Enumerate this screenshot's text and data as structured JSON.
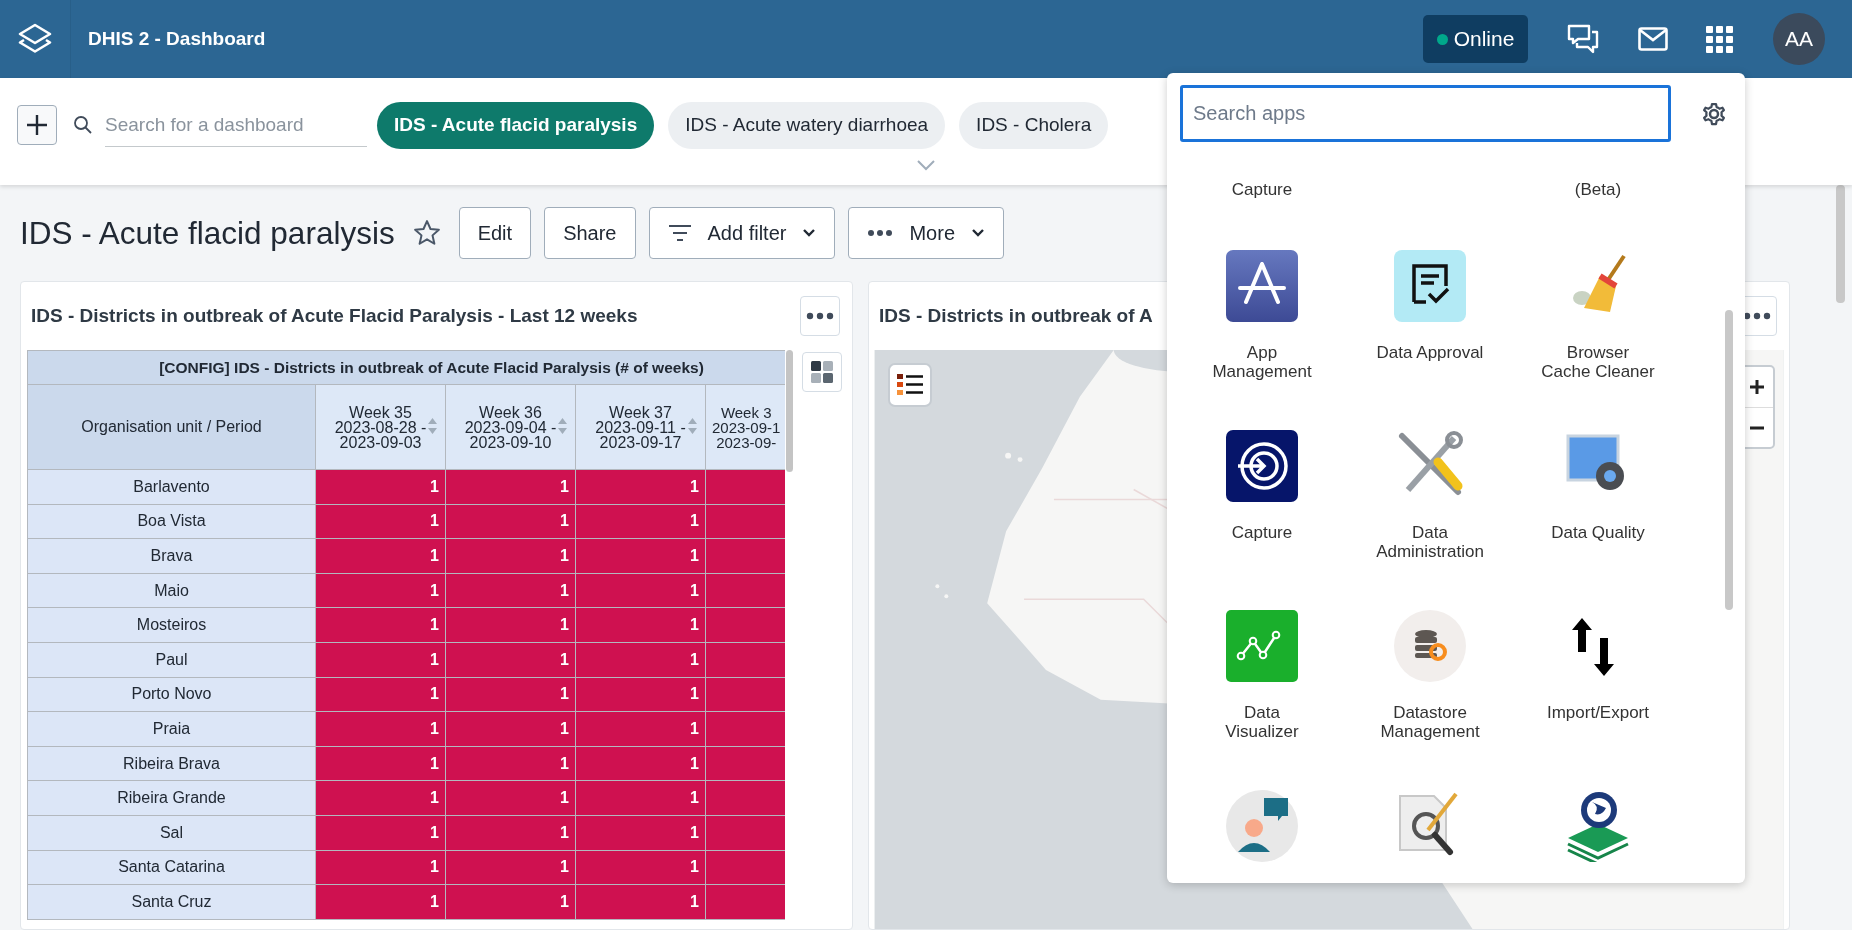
{
  "header": {
    "title": "DHIS 2 - Dashboard",
    "status": "Online",
    "avatar": "AA"
  },
  "dashboard_bar": {
    "search": {
      "placeholder": "Search for a dashboard"
    },
    "chips": [
      {
        "label": "IDS - Acute flacid paralysis",
        "selected": true
      },
      {
        "label": "IDS - Acute watery diarrhoea",
        "selected": false
      },
      {
        "label": "IDS - Cholera",
        "selected": false
      }
    ]
  },
  "dashboard": {
    "title": "IDS - Acute flacid paralysis",
    "starred": false,
    "buttons": [
      {
        "label": "Edit",
        "kind": "plain"
      },
      {
        "label": "Share",
        "kind": "plain"
      },
      {
        "label": "Add filter",
        "kind": "filter"
      },
      {
        "label": "More",
        "kind": "more"
      }
    ]
  },
  "table_item": {
    "title": "IDS - Districts in outbreak of Acute Flacid Paralysis - Last 12 weeks",
    "table": {
      "caption": "[CONFIG] IDS - Districts in outbreak of Acute Flacid Paralysis (# of weeks)",
      "corner": "Organisation unit / Period",
      "columns": [
        {
          "lines": [
            "Week 35",
            "2023-08-28 -",
            "2023-09-03"
          ],
          "sortable": true
        },
        {
          "lines": [
            "Week 36",
            "2023-09-04 -",
            "2023-09-10"
          ],
          "sortable": true
        },
        {
          "lines": [
            "Week 37",
            "2023-09-11 -",
            "2023-09-17"
          ],
          "sortable": true
        },
        {
          "lines": [
            "Week 3",
            "2023-09-1",
            "2023-09-"
          ],
          "sortable": false
        }
      ],
      "rows": [
        {
          "name": "Barlavento",
          "values": [
            "1",
            "1",
            "1"
          ]
        },
        {
          "name": "Boa Vista",
          "values": [
            "1",
            "1",
            "1"
          ]
        },
        {
          "name": "Brava",
          "values": [
            "1",
            "1",
            "1"
          ]
        },
        {
          "name": "Maio",
          "values": [
            "1",
            "1",
            "1"
          ]
        },
        {
          "name": "Mosteiros",
          "values": [
            "1",
            "1",
            "1"
          ]
        },
        {
          "name": "Paul",
          "values": [
            "1",
            "1",
            "1"
          ]
        },
        {
          "name": "Porto Novo",
          "values": [
            "1",
            "1",
            "1"
          ]
        },
        {
          "name": "Praia",
          "values": [
            "1",
            "1",
            "1"
          ]
        },
        {
          "name": "Ribeira Brava",
          "values": [
            "1",
            "1",
            "1"
          ]
        },
        {
          "name": "Ribeira Grande",
          "values": [
            "1",
            "1",
            "1"
          ]
        },
        {
          "name": "Sal",
          "values": [
            "1",
            "1",
            "1"
          ]
        },
        {
          "name": "Santa Catarina",
          "values": [
            "1",
            "1",
            "1"
          ]
        },
        {
          "name": "Santa Cruz",
          "values": [
            "1",
            "1",
            "1"
          ]
        }
      ]
    }
  },
  "map_item": {
    "title": "IDS - Districts in outbreak of A"
  },
  "apps_menu": {
    "search": {
      "placeholder": "Search apps"
    },
    "cut_labels": [
      {
        "label": "Capture"
      },
      {
        "label": "(Beta)"
      }
    ],
    "apps": [
      {
        "label": "App\nManagement",
        "kind": "app-management"
      },
      {
        "label": "Data Approval",
        "kind": "approval"
      },
      {
        "label": "Browser\nCache Cleaner",
        "kind": "broom"
      },
      {
        "label": "Capture",
        "kind": "capture"
      },
      {
        "label": "Data\nAdministration",
        "kind": "tools"
      },
      {
        "label": "Data Quality",
        "kind": "quality"
      },
      {
        "label": "Data\nVisualizer",
        "kind": "visualizer"
      },
      {
        "label": "Datastore\nManagement",
        "kind": "datastore"
      },
      {
        "label": "Import/Export",
        "kind": "import-export"
      },
      {
        "kind": "messaging"
      },
      {
        "kind": "reports"
      },
      {
        "kind": "maps"
      }
    ]
  }
}
